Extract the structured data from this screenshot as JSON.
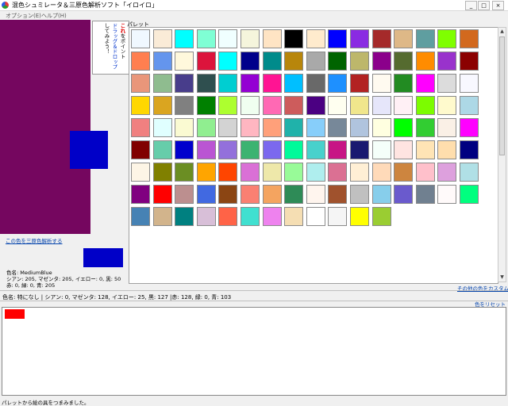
{
  "window": {
    "title": "混色シュミレータ＆三原色解析ソフト「イロイロ」",
    "controls": [
      "_",
      "□",
      "×"
    ]
  },
  "menu": [
    "オプション(E)",
    "ヘルプ(H)"
  ],
  "speech": {
    "line1": "これ",
    "line1_rest": "をポイント",
    "line2": "ドラッグ＆ドロップ",
    "line3": "してみよう！",
    "accent_red": "#e00000",
    "accent_green": "#008800"
  },
  "palette": {
    "label": "パレット",
    "colors": [
      "#f0f8ff",
      "#faebd7",
      "#00ffff",
      "#7fffd4",
      "#f0ffff",
      "#f5f5dc",
      "#ffe4c4",
      "#000000",
      "#ffebcd",
      "#0000ff",
      "#8a2be2",
      "#a52a2a",
      "#deb887",
      "#5f9ea0",
      "#7fff00",
      "#d2691e",
      "#ff7f50",
      "#6495ed",
      "#fff8dc",
      "#dc143c",
      "#00ffff",
      "#00008b",
      "#008b8b",
      "#b8860b",
      "#a9a9a9",
      "#006400",
      "#bdb76b",
      "#8b008b",
      "#556b2f",
      "#ff8c00",
      "#9932cc",
      "#8b0000",
      "#e9967a",
      "#8fbc8f",
      "#483d8b",
      "#2f4f4f",
      "#00ced1",
      "#9400d3",
      "#ff1493",
      "#00bfff",
      "#696969",
      "#1e90ff",
      "#b22222",
      "#fffaf0",
      "#228b22",
      "#ff00ff",
      "#dcdcdc",
      "#f8f8ff",
      "#ffd700",
      "#daa520",
      "#808080",
      "#008000",
      "#adff2f",
      "#f0fff0",
      "#ff69b4",
      "#cd5c5c",
      "#4b0082",
      "#fffff0",
      "#f0e68c",
      "#e6e6fa",
      "#fff0f5",
      "#7cfc00",
      "#fffacd",
      "#add8e6",
      "#f08080",
      "#e0ffff",
      "#fafad2",
      "#90ee90",
      "#d3d3d3",
      "#ffb6c1",
      "#ffa07a",
      "#20b2aa",
      "#87cefa",
      "#778899",
      "#b0c4de",
      "#ffffe0",
      "#00ff00",
      "#32cd32",
      "#faf0e6",
      "#ff00ff",
      "#800000",
      "#66cdaa",
      "#0000cd",
      "#ba55d3",
      "#9370db",
      "#3cb371",
      "#7b68ee",
      "#00fa9a",
      "#48d1cc",
      "#c71585",
      "#191970",
      "#f5fffa",
      "#ffe4e1",
      "#ffe4b5",
      "#ffdead",
      "#000080",
      "#fdf5e6",
      "#808000",
      "#6b8e23",
      "#ffa500",
      "#ff4500",
      "#da70d6",
      "#eee8aa",
      "#98fb98",
      "#afeeee",
      "#db7093",
      "#ffefd5",
      "#ffdab9",
      "#cd853f",
      "#ffc0cb",
      "#dda0dd",
      "#b0e0e6",
      "#800080",
      "#ff0000",
      "#bc8f8f",
      "#4169e1",
      "#8b4513",
      "#fa8072",
      "#f4a460",
      "#2e8b57",
      "#fff5ee",
      "#a0522d",
      "#c0c0c0",
      "#87ceeb",
      "#6a5acd",
      "#708090",
      "#fffafa",
      "#00ff7f",
      "#4682b4",
      "#d2b48c",
      "#008080",
      "#d8bfd8",
      "#ff6347",
      "#40e0d0",
      "#ee82ee",
      "#f5deb3",
      "#ffffff",
      "#f5f5f5",
      "#ffff00",
      "#9acd32"
    ]
  },
  "left": {
    "target_color": "#75065f",
    "dropped_color": "#0000c8",
    "analyze_link": "この色を三原色解析する",
    "selected_color": "#0000c8",
    "color_name": "色名: MediumBlue",
    "cmyk": "シアン: 205, マゼンタ: 205, イエロー: 0, 黒: 50",
    "rgb": "赤: 0, 緑: 0, 青: 205"
  },
  "custom_link": "その他の色をカスタム",
  "status": {
    "mix_info": "色名: 特になし | シアン: 0, マゼンタ: 128, イエロー: 25, 黒: 127 |赤: 128, 緑: 0, 青: 103",
    "reset_link": "色をリセット",
    "mix_chip_color": "#ff0000",
    "bottom": "パレットから絵の具をつまみました。"
  }
}
